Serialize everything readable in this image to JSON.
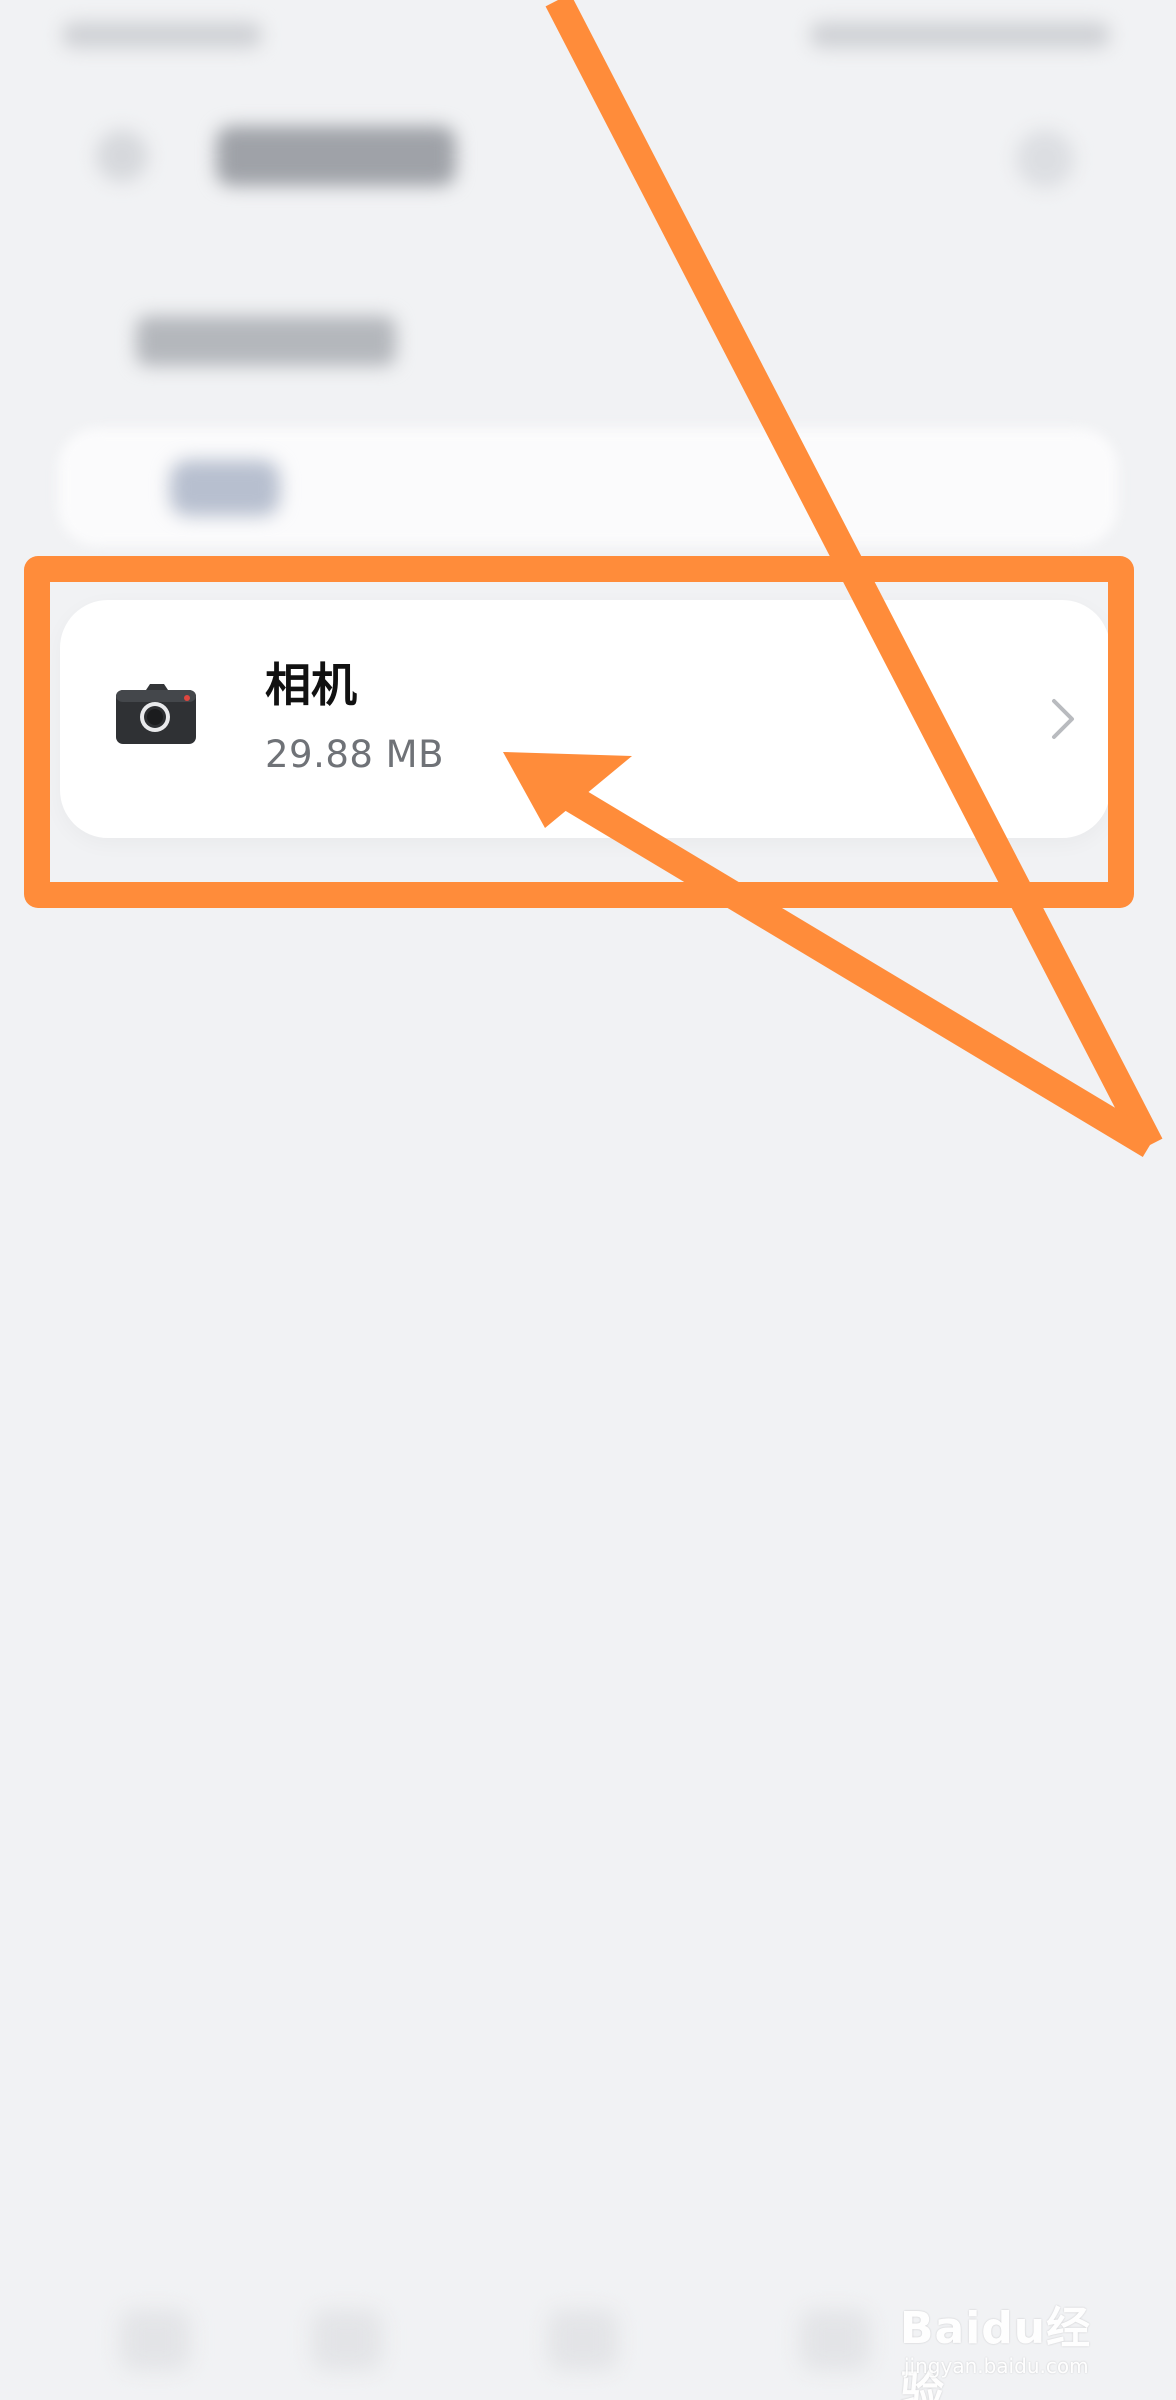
{
  "app_list": {
    "items": [
      {
        "name": "相机",
        "size": "29.88 MB",
        "icon": "camera-icon"
      }
    ]
  },
  "annotation": {
    "color": "#ff8c3a"
  },
  "watermark": {
    "main": "Baidu经验",
    "sub": "jingyan.baidu.com"
  },
  "colors": {
    "background": "#f1f2f4",
    "card": "#ffffff",
    "primary_text": "#111111",
    "secondary_text": "#6f7277"
  }
}
